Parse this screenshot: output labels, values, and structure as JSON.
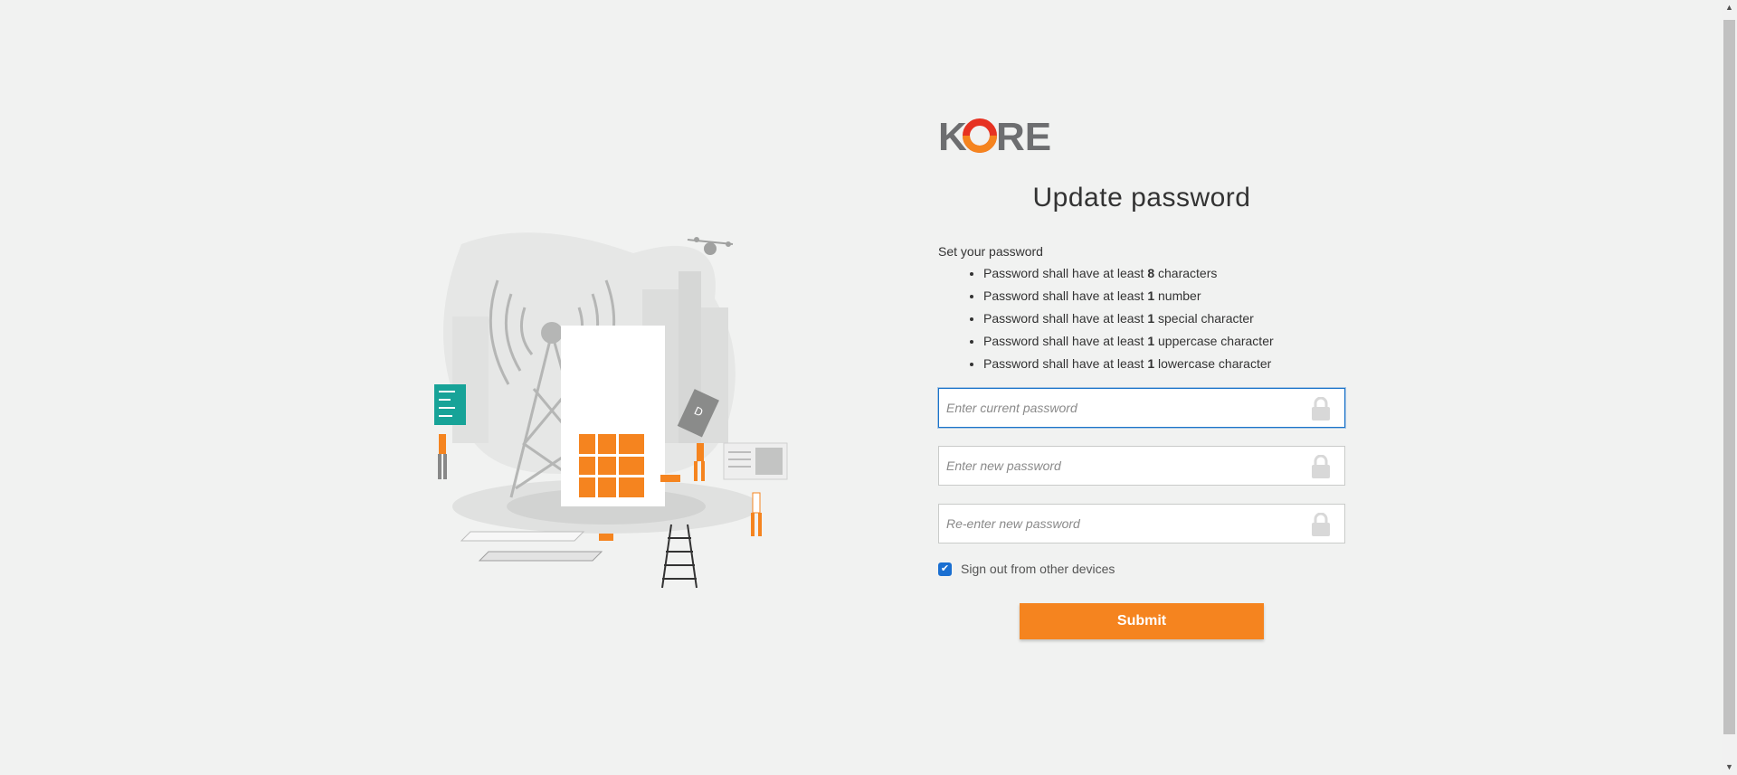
{
  "brand": {
    "logo_text": "KORE",
    "accent": "#f5841f",
    "primary": "#1a6fd1"
  },
  "page": {
    "title": "Update password",
    "intro": "Set your password"
  },
  "rules": [
    {
      "prefix": "Password shall have at least ",
      "value": "8",
      "suffix": " characters"
    },
    {
      "prefix": "Password shall have at least ",
      "value": "1",
      "suffix": " number"
    },
    {
      "prefix": "Password shall have at least ",
      "value": "1",
      "suffix": " special character"
    },
    {
      "prefix": "Password shall have at least ",
      "value": "1",
      "suffix": " uppercase character"
    },
    {
      "prefix": "Password shall have at least ",
      "value": "1",
      "suffix": " lowercase character"
    }
  ],
  "fields": {
    "current": {
      "placeholder": "Enter current password",
      "value": ""
    },
    "new": {
      "placeholder": "Enter new password",
      "value": ""
    },
    "confirm": {
      "placeholder": "Re-enter new password",
      "value": ""
    }
  },
  "signout": {
    "label": "Sign out from other devices",
    "checked": true
  },
  "submit": {
    "label": "Submit"
  },
  "icons": [
    "lock-icon",
    "checkmark-icon",
    "scroll-up-icon",
    "scroll-down-icon"
  ]
}
